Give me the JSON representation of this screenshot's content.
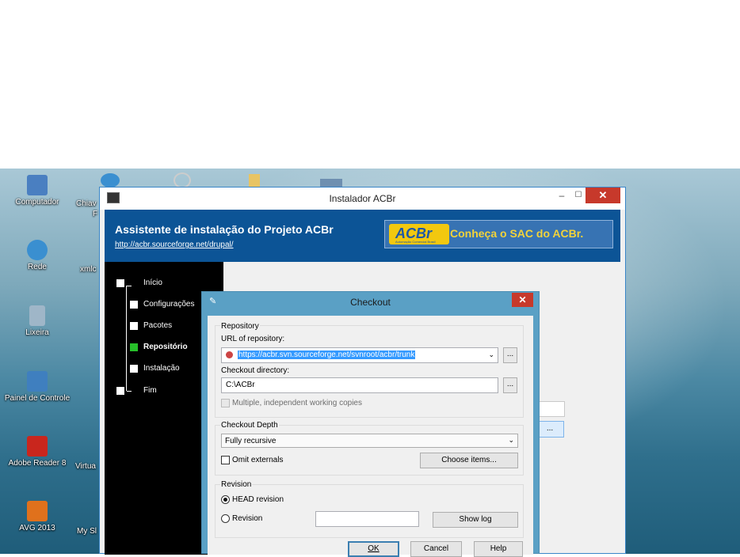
{
  "desktop": {
    "icons": [
      {
        "label": "Computador",
        "icon": "computer-icon",
        "color": "#4a7fc1"
      },
      {
        "label": "Rede",
        "icon": "network-globe-icon",
        "color": "#3a8fd0"
      },
      {
        "label": "Lixeira",
        "icon": "recycle-bin-icon",
        "color": "#9fb6c8"
      },
      {
        "label": "Painel de Controle",
        "icon": "control-panel-icon",
        "color": "#3f7fbf"
      },
      {
        "label": "Adobe Reader 8",
        "icon": "adobe-reader-icon",
        "color": "#c9261d"
      },
      {
        "label": "AVG 2013",
        "icon": "avg-icon",
        "color": "#e0711c"
      }
    ],
    "truncated_labels": [
      "Chiav",
      "F",
      "xmlc",
      "Virtua",
      "My Sl"
    ]
  },
  "installer": {
    "title": "Instalador ACBr",
    "header_title": "Assistente de instalação do Projeto ACBr",
    "header_link": "http://acbr.sourceforge.net/drupal/",
    "banner_logo": "ACBr",
    "banner_logo_sub": "Automação Comercial Brasil",
    "banner_text": "Conheça o SAC do ACBr.",
    "steps": [
      "Início",
      "Configurações",
      "Pacotes",
      "Repositório",
      "Instalação",
      "Fim"
    ],
    "active_step": "Repositório",
    "bg_button_label": "...",
    "minimize": "–",
    "maximize": "☐",
    "close": "✕"
  },
  "checkout": {
    "title": "Checkout",
    "close": "✕",
    "repository_group": "Repository",
    "url_label": "URL of repository:",
    "url_value": "https://acbr.svn.sourceforge.net/svnroot/acbr/trunk",
    "browse_label": "...",
    "dir_label": "Checkout directory:",
    "dir_value": "C:\\ACBr",
    "multiple_label": "Multiple, independent working copies",
    "depth_group": "Checkout Depth",
    "depth_value": "Fully recursive",
    "omit_label": "Omit externals",
    "choose_items": "Choose items...",
    "revision_group": "Revision",
    "head_revision": "HEAD revision",
    "revision_label": "Revision",
    "show_log": "Show log",
    "ok": "OK",
    "cancel": "Cancel",
    "help": "Help"
  }
}
